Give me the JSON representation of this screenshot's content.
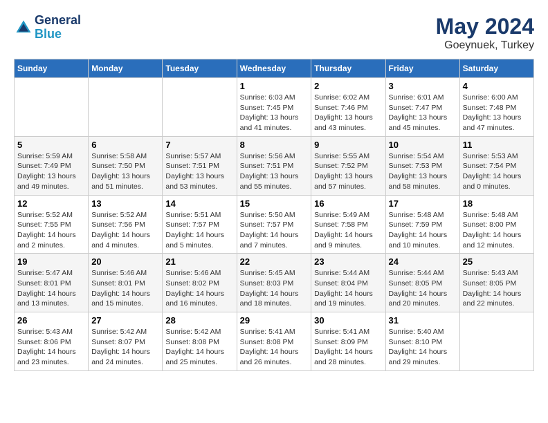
{
  "header": {
    "logo_line1": "General",
    "logo_line2": "Blue",
    "month": "May 2024",
    "location": "Goeynuek, Turkey"
  },
  "weekdays": [
    "Sunday",
    "Monday",
    "Tuesday",
    "Wednesday",
    "Thursday",
    "Friday",
    "Saturday"
  ],
  "weeks": [
    [
      {
        "day": "",
        "info": ""
      },
      {
        "day": "",
        "info": ""
      },
      {
        "day": "",
        "info": ""
      },
      {
        "day": "1",
        "info": "Sunrise: 6:03 AM\nSunset: 7:45 PM\nDaylight: 13 hours\nand 41 minutes."
      },
      {
        "day": "2",
        "info": "Sunrise: 6:02 AM\nSunset: 7:46 PM\nDaylight: 13 hours\nand 43 minutes."
      },
      {
        "day": "3",
        "info": "Sunrise: 6:01 AM\nSunset: 7:47 PM\nDaylight: 13 hours\nand 45 minutes."
      },
      {
        "day": "4",
        "info": "Sunrise: 6:00 AM\nSunset: 7:48 PM\nDaylight: 13 hours\nand 47 minutes."
      }
    ],
    [
      {
        "day": "5",
        "info": "Sunrise: 5:59 AM\nSunset: 7:49 PM\nDaylight: 13 hours\nand 49 minutes."
      },
      {
        "day": "6",
        "info": "Sunrise: 5:58 AM\nSunset: 7:50 PM\nDaylight: 13 hours\nand 51 minutes."
      },
      {
        "day": "7",
        "info": "Sunrise: 5:57 AM\nSunset: 7:51 PM\nDaylight: 13 hours\nand 53 minutes."
      },
      {
        "day": "8",
        "info": "Sunrise: 5:56 AM\nSunset: 7:51 PM\nDaylight: 13 hours\nand 55 minutes."
      },
      {
        "day": "9",
        "info": "Sunrise: 5:55 AM\nSunset: 7:52 PM\nDaylight: 13 hours\nand 57 minutes."
      },
      {
        "day": "10",
        "info": "Sunrise: 5:54 AM\nSunset: 7:53 PM\nDaylight: 13 hours\nand 58 minutes."
      },
      {
        "day": "11",
        "info": "Sunrise: 5:53 AM\nSunset: 7:54 PM\nDaylight: 14 hours\nand 0 minutes."
      }
    ],
    [
      {
        "day": "12",
        "info": "Sunrise: 5:52 AM\nSunset: 7:55 PM\nDaylight: 14 hours\nand 2 minutes."
      },
      {
        "day": "13",
        "info": "Sunrise: 5:52 AM\nSunset: 7:56 PM\nDaylight: 14 hours\nand 4 minutes."
      },
      {
        "day": "14",
        "info": "Sunrise: 5:51 AM\nSunset: 7:57 PM\nDaylight: 14 hours\nand 5 minutes."
      },
      {
        "day": "15",
        "info": "Sunrise: 5:50 AM\nSunset: 7:57 PM\nDaylight: 14 hours\nand 7 minutes."
      },
      {
        "day": "16",
        "info": "Sunrise: 5:49 AM\nSunset: 7:58 PM\nDaylight: 14 hours\nand 9 minutes."
      },
      {
        "day": "17",
        "info": "Sunrise: 5:48 AM\nSunset: 7:59 PM\nDaylight: 14 hours\nand 10 minutes."
      },
      {
        "day": "18",
        "info": "Sunrise: 5:48 AM\nSunset: 8:00 PM\nDaylight: 14 hours\nand 12 minutes."
      }
    ],
    [
      {
        "day": "19",
        "info": "Sunrise: 5:47 AM\nSunset: 8:01 PM\nDaylight: 14 hours\nand 13 minutes."
      },
      {
        "day": "20",
        "info": "Sunrise: 5:46 AM\nSunset: 8:01 PM\nDaylight: 14 hours\nand 15 minutes."
      },
      {
        "day": "21",
        "info": "Sunrise: 5:46 AM\nSunset: 8:02 PM\nDaylight: 14 hours\nand 16 minutes."
      },
      {
        "day": "22",
        "info": "Sunrise: 5:45 AM\nSunset: 8:03 PM\nDaylight: 14 hours\nand 18 minutes."
      },
      {
        "day": "23",
        "info": "Sunrise: 5:44 AM\nSunset: 8:04 PM\nDaylight: 14 hours\nand 19 minutes."
      },
      {
        "day": "24",
        "info": "Sunrise: 5:44 AM\nSunset: 8:05 PM\nDaylight: 14 hours\nand 20 minutes."
      },
      {
        "day": "25",
        "info": "Sunrise: 5:43 AM\nSunset: 8:05 PM\nDaylight: 14 hours\nand 22 minutes."
      }
    ],
    [
      {
        "day": "26",
        "info": "Sunrise: 5:43 AM\nSunset: 8:06 PM\nDaylight: 14 hours\nand 23 minutes."
      },
      {
        "day": "27",
        "info": "Sunrise: 5:42 AM\nSunset: 8:07 PM\nDaylight: 14 hours\nand 24 minutes."
      },
      {
        "day": "28",
        "info": "Sunrise: 5:42 AM\nSunset: 8:08 PM\nDaylight: 14 hours\nand 25 minutes."
      },
      {
        "day": "29",
        "info": "Sunrise: 5:41 AM\nSunset: 8:08 PM\nDaylight: 14 hours\nand 26 minutes."
      },
      {
        "day": "30",
        "info": "Sunrise: 5:41 AM\nSunset: 8:09 PM\nDaylight: 14 hours\nand 28 minutes."
      },
      {
        "day": "31",
        "info": "Sunrise: 5:40 AM\nSunset: 8:10 PM\nDaylight: 14 hours\nand 29 minutes."
      },
      {
        "day": "",
        "info": ""
      }
    ]
  ]
}
